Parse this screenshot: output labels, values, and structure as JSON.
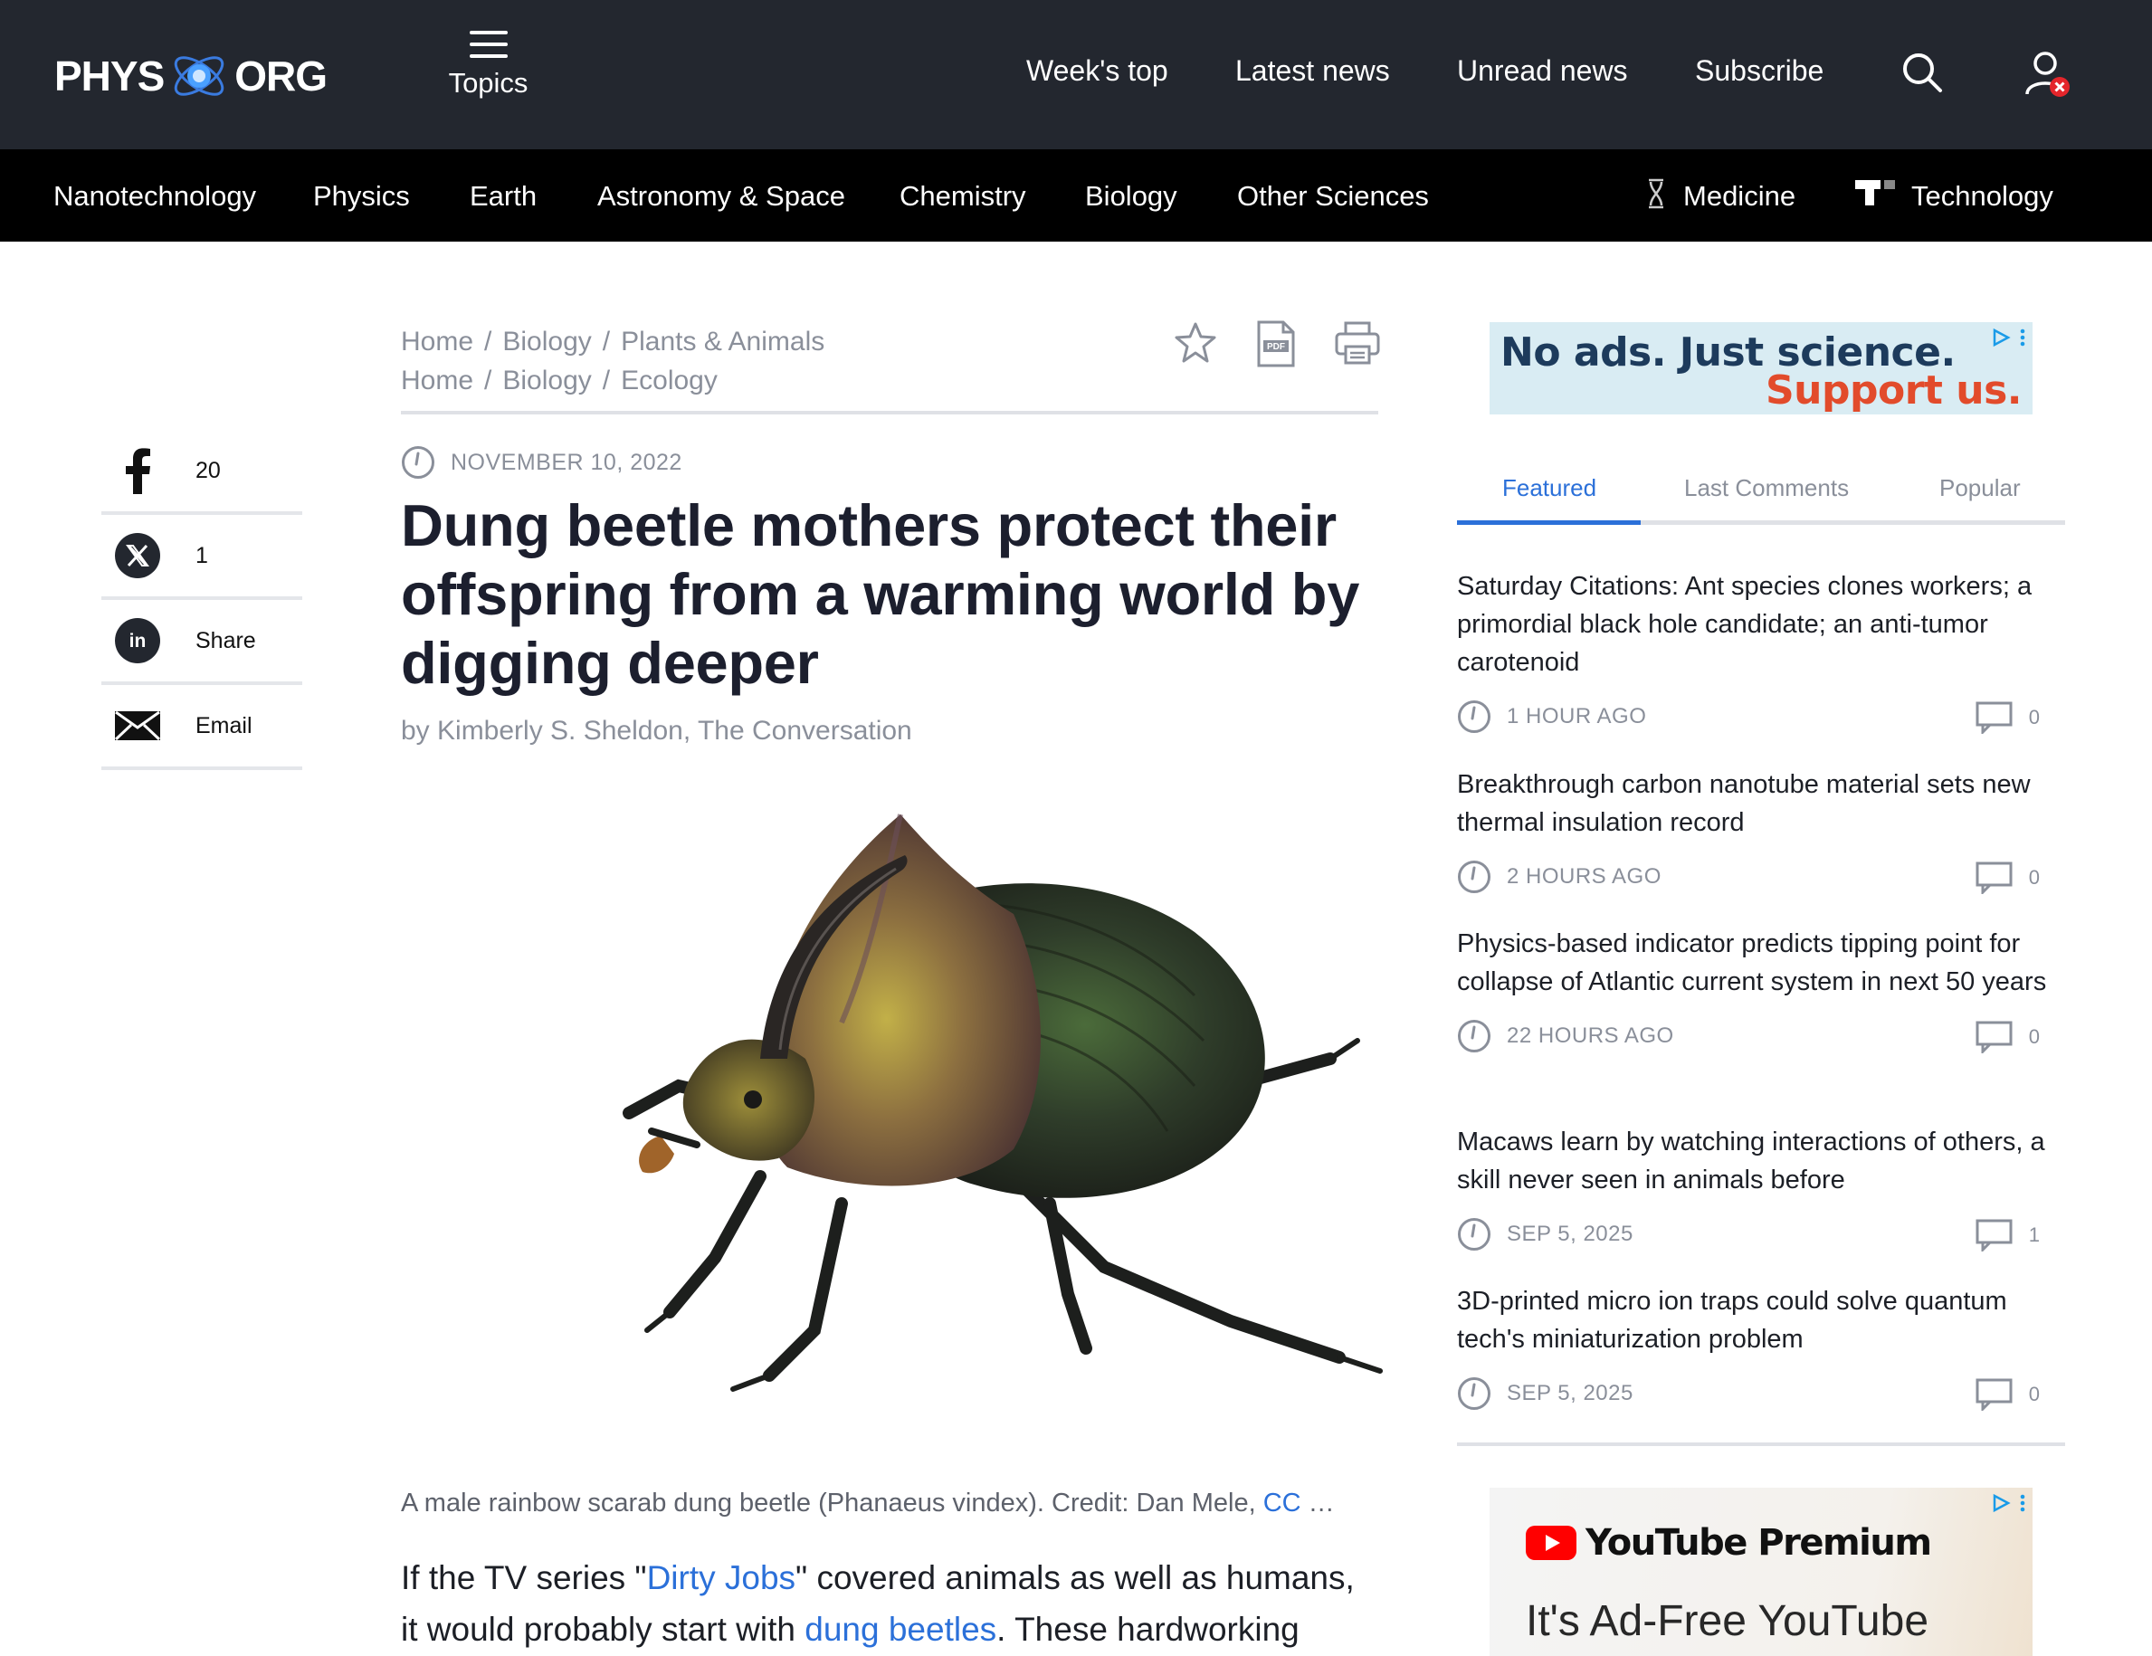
{
  "header": {
    "logo_left": "PHYS",
    "logo_right": "ORG",
    "topics_label": "Topics",
    "nav": [
      "Week's top",
      "Latest news",
      "Unread news",
      "Subscribe"
    ]
  },
  "categories": {
    "items": [
      "Nanotechnology",
      "Physics",
      "Earth",
      "Astronomy & Space",
      "Chemistry",
      "Biology",
      "Other Sciences"
    ],
    "medicine": "Medicine",
    "technology": "Technology"
  },
  "share": {
    "facebook_count": "20",
    "x_count": "1",
    "linkedin_label": "Share",
    "email_label": "Email"
  },
  "breadcrumbs": [
    [
      "Home",
      "Biology",
      "Plants & Animals"
    ],
    [
      "Home",
      "Biology",
      "Ecology"
    ]
  ],
  "article": {
    "date": "NOVEMBER 10, 2022",
    "title": "Dung beetle mothers protect their offspring from a warming world by digging deeper",
    "byline": "by Kimberly S. Sheldon, The Conversation",
    "caption_text": "A male rainbow scarab dung beetle (Phanaeus vindex). Credit: Dan Mele, ",
    "caption_link": "CC",
    "caption_more": " …",
    "body_1": "If the TV series \"",
    "body_link_1": "Dirty Jobs",
    "body_2": "\" covered animals as well as humans, it would probably start with ",
    "body_link_2": "dung beetles",
    "body_3": ". These hardworking"
  },
  "ad_top": {
    "line1": "No ads. Just science.",
    "line2": "Support us."
  },
  "sidebar": {
    "tabs": [
      "Featured",
      "Last Comments",
      "Popular"
    ],
    "news": [
      {
        "title": "Saturday Citations: Ant species clones workers; a primordial black hole candidate; an anti-tumor carotenoid",
        "ago": "1 HOUR AGO",
        "comments": "0"
      },
      {
        "title": "Breakthrough carbon nanotube material sets new thermal insulation record",
        "ago": "2 HOURS AGO",
        "comments": "0"
      },
      {
        "title": "Physics-based indicator predicts tipping point for collapse of Atlantic current system in next 50 years",
        "ago": "22 HOURS AGO",
        "comments": "0"
      },
      {
        "title": "Macaws learn by watching interactions of others, a skill never seen in animals before",
        "ago": "SEP 5, 2025",
        "comments": "1"
      },
      {
        "title": "3D-printed micro ion traps could solve quantum tech's miniaturization problem",
        "ago": "SEP 5, 2025",
        "comments": "0"
      }
    ]
  },
  "ad_bottom": {
    "brand": "YouTube Premium",
    "tagline": "It's Ad-Free YouTube"
  },
  "colors": {
    "header_bg": "#23272f",
    "category_bg": "#000000",
    "link_blue": "#2b70d9",
    "meta_gray": "#8a8f9a"
  }
}
